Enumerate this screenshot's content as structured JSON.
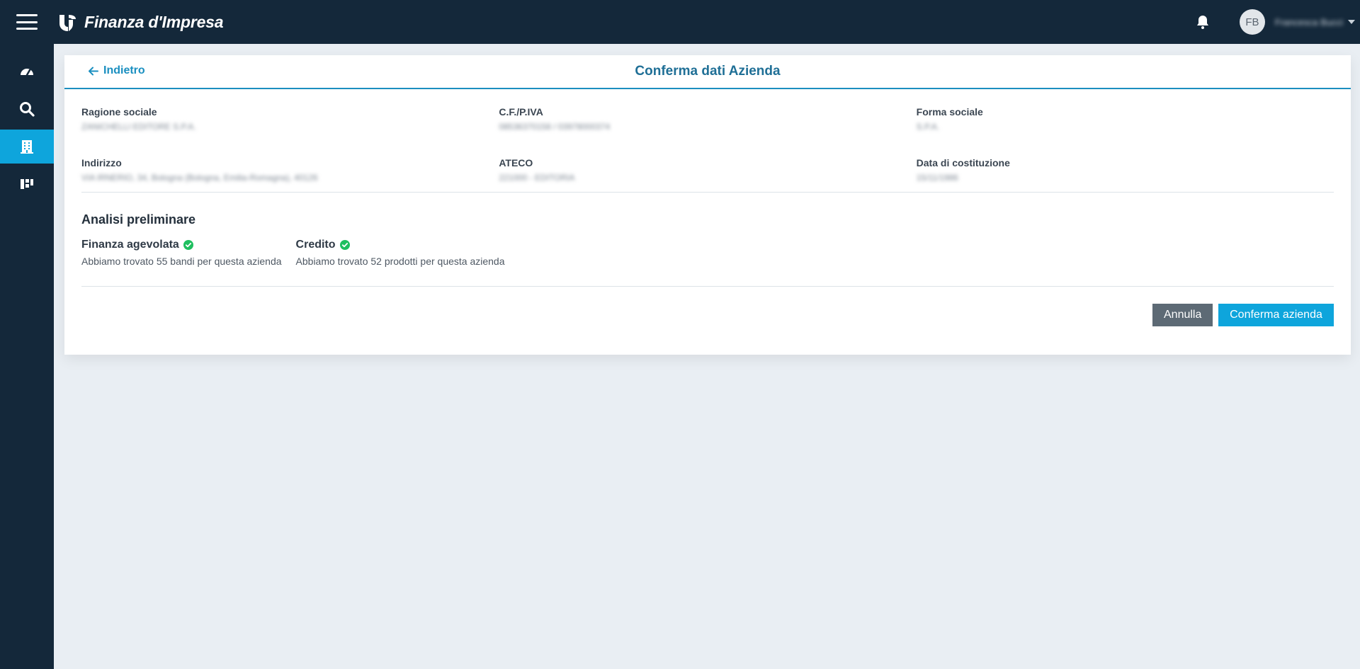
{
  "app": {
    "brand_name": "Finanza d'Impresa",
    "user_initials": "FB",
    "user_name": "Francesca Bucci"
  },
  "icons": {
    "menu": "hamburger-icon",
    "logo": "logo-icon",
    "notifications": "bell-icon",
    "user_menu": "chevron-down-icon",
    "back": "arrow-left-icon",
    "check": "check-circle-icon"
  },
  "sidebar": {
    "items": [
      {
        "name": "dashboard",
        "icon": "speedometer-icon",
        "active": false
      },
      {
        "name": "search",
        "icon": "search-icon",
        "active": false
      },
      {
        "name": "companies",
        "icon": "building-icon",
        "active": true
      },
      {
        "name": "boards",
        "icon": "grid-icon",
        "active": false
      }
    ]
  },
  "header": {
    "back_label": "Indietro",
    "title": "Conferma dati Azienda"
  },
  "company": {
    "ragione_sociale": {
      "label": "Ragione sociale",
      "value": "ZANICHELLI EDITORE S.P.A."
    },
    "cf_piva": {
      "label": "C.F./P.IVA",
      "value": "08536370158 / 03978000374"
    },
    "forma_sociale": {
      "label": "Forma sociale",
      "value": "S.P.A."
    },
    "indirizzo": {
      "label": "Indirizzo",
      "value": "VIA IRNERIO, 34, Bologna (Bologna, Emilia-Romagna), 40126"
    },
    "ateco": {
      "label": "ATECO",
      "value": "221000 - EDITORIA"
    },
    "data_costituzione": {
      "label": "Data di costituzione",
      "value": "15/11/1986"
    }
  },
  "analisi": {
    "title": "Analisi preliminare",
    "items": [
      {
        "title": "Finanza agevolata",
        "description": "Abbiamo trovato 55 bandi per questa azienda"
      },
      {
        "title": "Credito",
        "description": "Abbiamo trovato 52 prodotti per questa azienda"
      }
    ]
  },
  "actions": {
    "cancel_label": "Annulla",
    "confirm_label": "Conferma azienda"
  },
  "colors": {
    "topbar": "#14283a",
    "accent": "#0ea5dc",
    "success": "#1fbf5f",
    "cancel_button": "#5d6a75",
    "background": "#e9eef3"
  }
}
